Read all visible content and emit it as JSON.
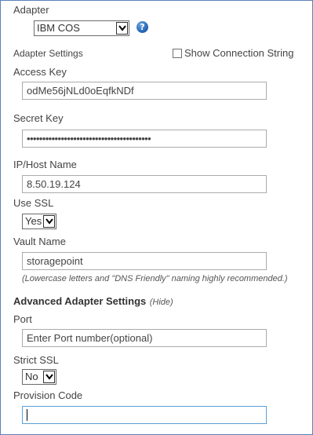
{
  "adapter": {
    "label": "Adapter",
    "selected": "IBM COS",
    "help_icon": "question-help-icon"
  },
  "adapter_settings": {
    "label": "Adapter Settings",
    "show_connection_string_label": "Show Connection String",
    "show_connection_string_checked": false
  },
  "access_key": {
    "label": "Access Key",
    "value": "odMe56jNLd0oEqfkNDf"
  },
  "secret_key": {
    "label": "Secret Key",
    "value": "••••••••••••••••••••••••••••••••••••••••"
  },
  "host": {
    "label": "IP/Host Name",
    "value": "8.50.19.124"
  },
  "use_ssl": {
    "label": "Use SSL",
    "selected": "Yes"
  },
  "vault": {
    "label": "Vault Name",
    "value": "storagepoint",
    "note": "(Lowercase letters and \"DNS Friendly\" naming highly recommended.)"
  },
  "advanced": {
    "title": "Advanced Adapter Settings",
    "toggle": "(Hide)"
  },
  "port": {
    "label": "Port",
    "value": "Enter Port number(optional)"
  },
  "strict_ssl": {
    "label": "Strict SSL",
    "selected": "No"
  },
  "provision_code": {
    "label": "Provision Code",
    "value": ""
  },
  "colors": {
    "frame_border": "#5a82b8",
    "focus_border": "#5aa0d8",
    "help_icon": "#1f5fb3"
  }
}
